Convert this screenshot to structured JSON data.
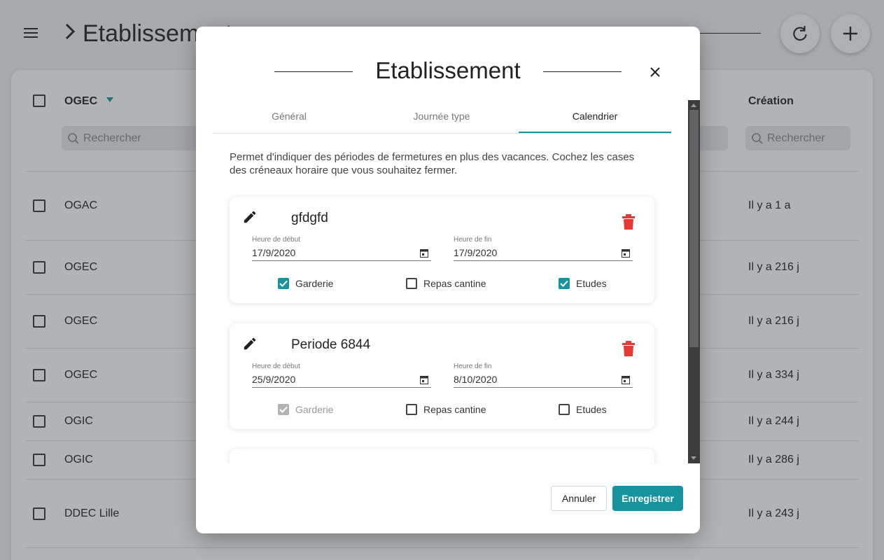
{
  "page": {
    "title": "Etablissements",
    "columns": {
      "name": "OGEC",
      "created": "Création"
    },
    "search_placeholder": "Rechercher",
    "rows": [
      {
        "name": "OGAC",
        "created": "Il y a 1 a"
      },
      {
        "name": "OGEC",
        "created": "Il y a 216 j"
      },
      {
        "name": "OGEC",
        "created": "Il y a 216 j"
      },
      {
        "name": "OGEC",
        "created": "Il y a 334 j"
      },
      {
        "name": "OGIC",
        "created": "Il y a 244 j"
      },
      {
        "name": "OGIC",
        "created": "Il y a 286 j"
      },
      {
        "name": "DDEC Lille",
        "created": "Il y a 243 j"
      }
    ]
  },
  "modal": {
    "title": "Etablissement",
    "tabs": [
      "Général",
      "Journée type",
      "Calendrier"
    ],
    "active_tab": "Calendrier",
    "description": "Permet d'indiquer des périodes de fermetures en plus des vacances. Cochez les cases des créneaux horaire que vous souhaitez fermer.",
    "start_label": "Heure de début",
    "end_label": "Heure de fin",
    "periods": [
      {
        "name": "gfdgfd",
        "start": "17/9/2020",
        "end": "17/9/2020",
        "options": [
          {
            "label": "Garderie",
            "checked": true,
            "disabled": false
          },
          {
            "label": "Repas cantine",
            "checked": false,
            "disabled": false
          },
          {
            "label": "Etudes",
            "checked": true,
            "disabled": false
          }
        ]
      },
      {
        "name": "Periode 6844",
        "start": "25/9/2020",
        "end": "8/10/2020",
        "options": [
          {
            "label": "Garderie",
            "checked": true,
            "disabled": true
          },
          {
            "label": "Repas cantine",
            "checked": false,
            "disabled": false
          },
          {
            "label": "Etudes",
            "checked": false,
            "disabled": false
          }
        ]
      }
    ],
    "cancel_label": "Annuler",
    "save_label": "Enregistrer"
  },
  "colors": {
    "accent": "#16939e",
    "danger": "#e53935",
    "overlay": "rgba(50,55,60,0.38)"
  },
  "icons": [
    "menu-icon",
    "chevron-right-icon",
    "refresh-icon",
    "plus-icon",
    "search-icon",
    "close-icon",
    "pencil-icon",
    "trash-icon",
    "calendar-icon",
    "check-icon"
  ]
}
